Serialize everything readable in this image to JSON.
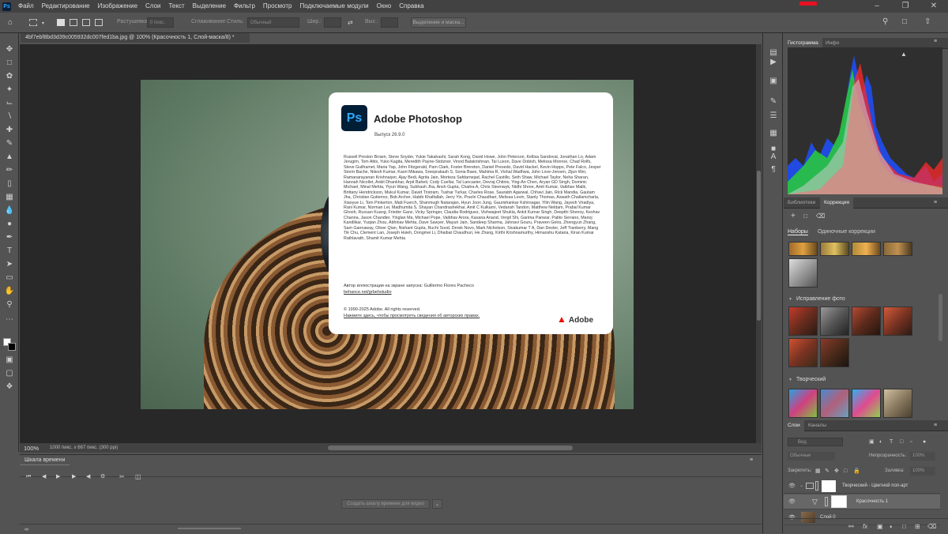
{
  "app": {
    "logo": "Ps",
    "menu": [
      "Файл",
      "Редактирование",
      "Изображение",
      "Слои",
      "Текст",
      "Выделение",
      "Фильтр",
      "Просмотр",
      "Подключаемые модули",
      "Окно",
      "Справка"
    ]
  },
  "options_bar": {
    "feather_label": "Растушевка:",
    "feather_value": "0 пикс.",
    "antialias_label": "Сглаживание",
    "style_label": "Стиль:",
    "style_value": "Обычный",
    "width_label": "Шир.:",
    "height_label": "Выс.:",
    "select_mask_button": "Выделение и маска..."
  },
  "document": {
    "tab_title": "4bf7ebf8bd3d39c005932dc007fed1ba.jpg @ 100% (Красочность 1, Слой-маска/8) *",
    "zoom": "100%",
    "info": "1000 пикс. x 667 пикс. (300 ppi)"
  },
  "about_dialog": {
    "logo": "Ps",
    "title": "Adobe Photoshop",
    "version": "Выпуск 26.9.0",
    "credits": "Russell Preston Brown, Steve Snyder, Yukie Takahashi, Sarah Kong, David Howe, John Peterson, Kellisa Sandoval, Jonathan Lo, Adam Jerugim, Tom Attix, Yuko Kagita, Meredith Payne-Stotzner, Vinod Balakrishnan, Tai Luxon, Dave Dobish, Melissa Monroe, Chad Rolfs, Steve Guilhamet, Maria Yap, John Fitzgerald, Pam Clark, Foster Brereton, Daniel Presedo, David Hackel, Kevin Hopps, Pete Falco, Jesper Storm Bache, Nitesh Kumar, Kaori Mikawa, Sreeprakash S, Sonia Baee, Mahima R, Vishal Wadhwa, John Love-Jensen, Zijun Wei, Ramanarayanan Krishnaiyer, Ajay Bedi, Agrita Jain, Morteza Safdarnejad, Rachel Castillo, Seth Shaw, Michael Taylor, Neha Sharan, Hannah Nicollet, Ankit Dhankhar, Arpit Baheti, Cody Cuellar, Tal Lancaster, Devraj Chitnis, Ying-An Chen, Aryan GD Singh, Dominic Michael, Minal Mehta, Yiyun Wang, Subhash Jha, Ansh Gupta, Chaitra A, Chris Steenwyk, Nidhi Shree, Amit Kumar, Vaibhav Malik, Brittany Hendrickson, Mukul Kumar, David Tristram, Tushar Turkar, Charles Rose, Saurabh Agarwal, Chhavi Jain, Rick Mandia, Gautam Jha, Christian Gutierrez, Bob Archer, Habib Khalfallah, Jerry Yin, Prachi Chaudhari, Melissa Levin, Stanly Thomas, Aswath Challamcharla, Xiaoyue Li, Tom Pinkerton, Matt Fuerch, Shanmugh Natarajan, Hyun Joon Jung, Gaurishankar Kshirsagar, Yilin Wang, Jayesh Viradiya, Rani Kumar, Norman Lei, Madhumita S, Shayan Chandrashekhar, Amit C Kulkarni, Vedansh Tandon, Matthew Neldam, Prabal Kumar Ghosh, Ruxuan Kuang, Frieder Ganz, Vicky Springer, Claudia Rodriguez, Vishwajeet Shukla, Ankit Kumar Singh, Deepthi Shenoy, Keshav Channa, Jason Chandler, Yinglan Ma, Michael Pope, Vaibhav Arora, Kavana Anand, Vergil Shi, Garima Panwar, Pablo Serrano, Manoj Kandlikar, Yuqian Zhou, Abhinav Mehta, Dave Sawyer, Mayuri Jain, Sandeep Sharma, Jahnavi Gouru, Praveen Gelra, Zhengyun Zhang, Sam Gannaway, Oliver Qian, Nishant Gupta, Ruchi Sood, Derek Novo, Mark Nicholson, Sivakumar T A, Dan Dexter, Jeff Tranberry, Mang Tik Chu, Clement Lan, Joseph Hsieh, Dongmei Li, Dhaibat Chaudhuri, He Zhang, Kirthi Krishnamurthy, Himanshu Kataria, Kiran Kumar Rathlavath, Shamit Kumar Mehta",
    "artist": "Автор иллюстрации на экране запуска: Guillermo Flores Pacheco",
    "artist_link": "behance.net/grbehstudio",
    "copyright": "© 1990-2025 Adobe. All rights reserved.",
    "legal_link": "Нажмите здесь, чтобы просмотреть сведения об авторских правах.",
    "brand": "Adobe"
  },
  "timeline": {
    "tab": "Шкала времени",
    "create_button": "Создать шкалу времени для видео"
  },
  "panels": {
    "histogram_tabs": [
      "Гистограмма",
      "Инфо"
    ],
    "adjust_tabs": [
      "Библиотеки",
      "Коррекция"
    ],
    "adjust_subtabs": [
      "Наборы",
      "Одиночные коррекции"
    ],
    "sections": [
      "Исправление фото",
      "Творческий"
    ],
    "layers_tabs": [
      "Слои",
      "Каналы"
    ],
    "layers_search": "Вид",
    "blend_mode": "Обычные",
    "opacity_label": "Непрозрачность:",
    "opacity_value": "100%",
    "lock_label": "Закрепить:",
    "fill_label": "Заливка:",
    "fill_value": "100%",
    "layers": [
      {
        "name": "Творческий - Цветной поп-арт"
      },
      {
        "name": "Красочность 1"
      },
      {
        "name": "Слой 0"
      }
    ]
  },
  "colors": {
    "accent_ps": "#31a8ff",
    "adobe_red": "#eb1000",
    "close_red": "#e81123"
  }
}
